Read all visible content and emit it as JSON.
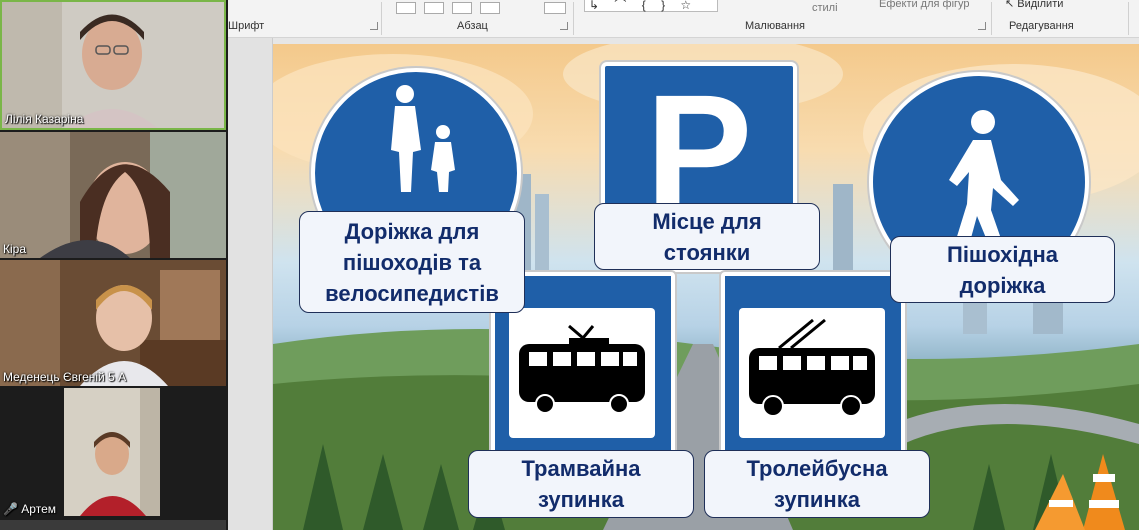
{
  "ribbon": {
    "groups": {
      "font": "Шрифт",
      "paragraph": "Абзац",
      "drawing": "Малювання",
      "editing": "Редагування"
    },
    "styles_label": "стилі",
    "shape_effects_label": "Ефекти для фігур",
    "select_label": "Виділити",
    "shapes_gallery_glyphs": "↳ ⌒ { } ☆"
  },
  "participants": [
    {
      "name": "Лілія Казаріна"
    },
    {
      "name": "Кіра"
    },
    {
      "name": "Меденець Євгеній 5 А"
    },
    {
      "name": "Артем"
    }
  ],
  "slide": {
    "labels": {
      "path_ped_bike_1": "Доріжка для",
      "path_ped_bike_2": "пішоходів та",
      "path_ped_bike_3": "велосипедистів",
      "parking_1": "Місце для",
      "parking_2": "стоянки",
      "footpath_1": "Пішохідна",
      "footpath_2": "доріжка",
      "tram_1": "Трамвайна",
      "tram_2": "зупинка",
      "trolley_1": "Тролейбусна",
      "trolley_2": "зупинка"
    },
    "parking_letter": "P"
  },
  "colors": {
    "sign_blue": "#1f5fa8",
    "caption_text": "#122c6b",
    "active_speaker_border": "#7ab648"
  }
}
